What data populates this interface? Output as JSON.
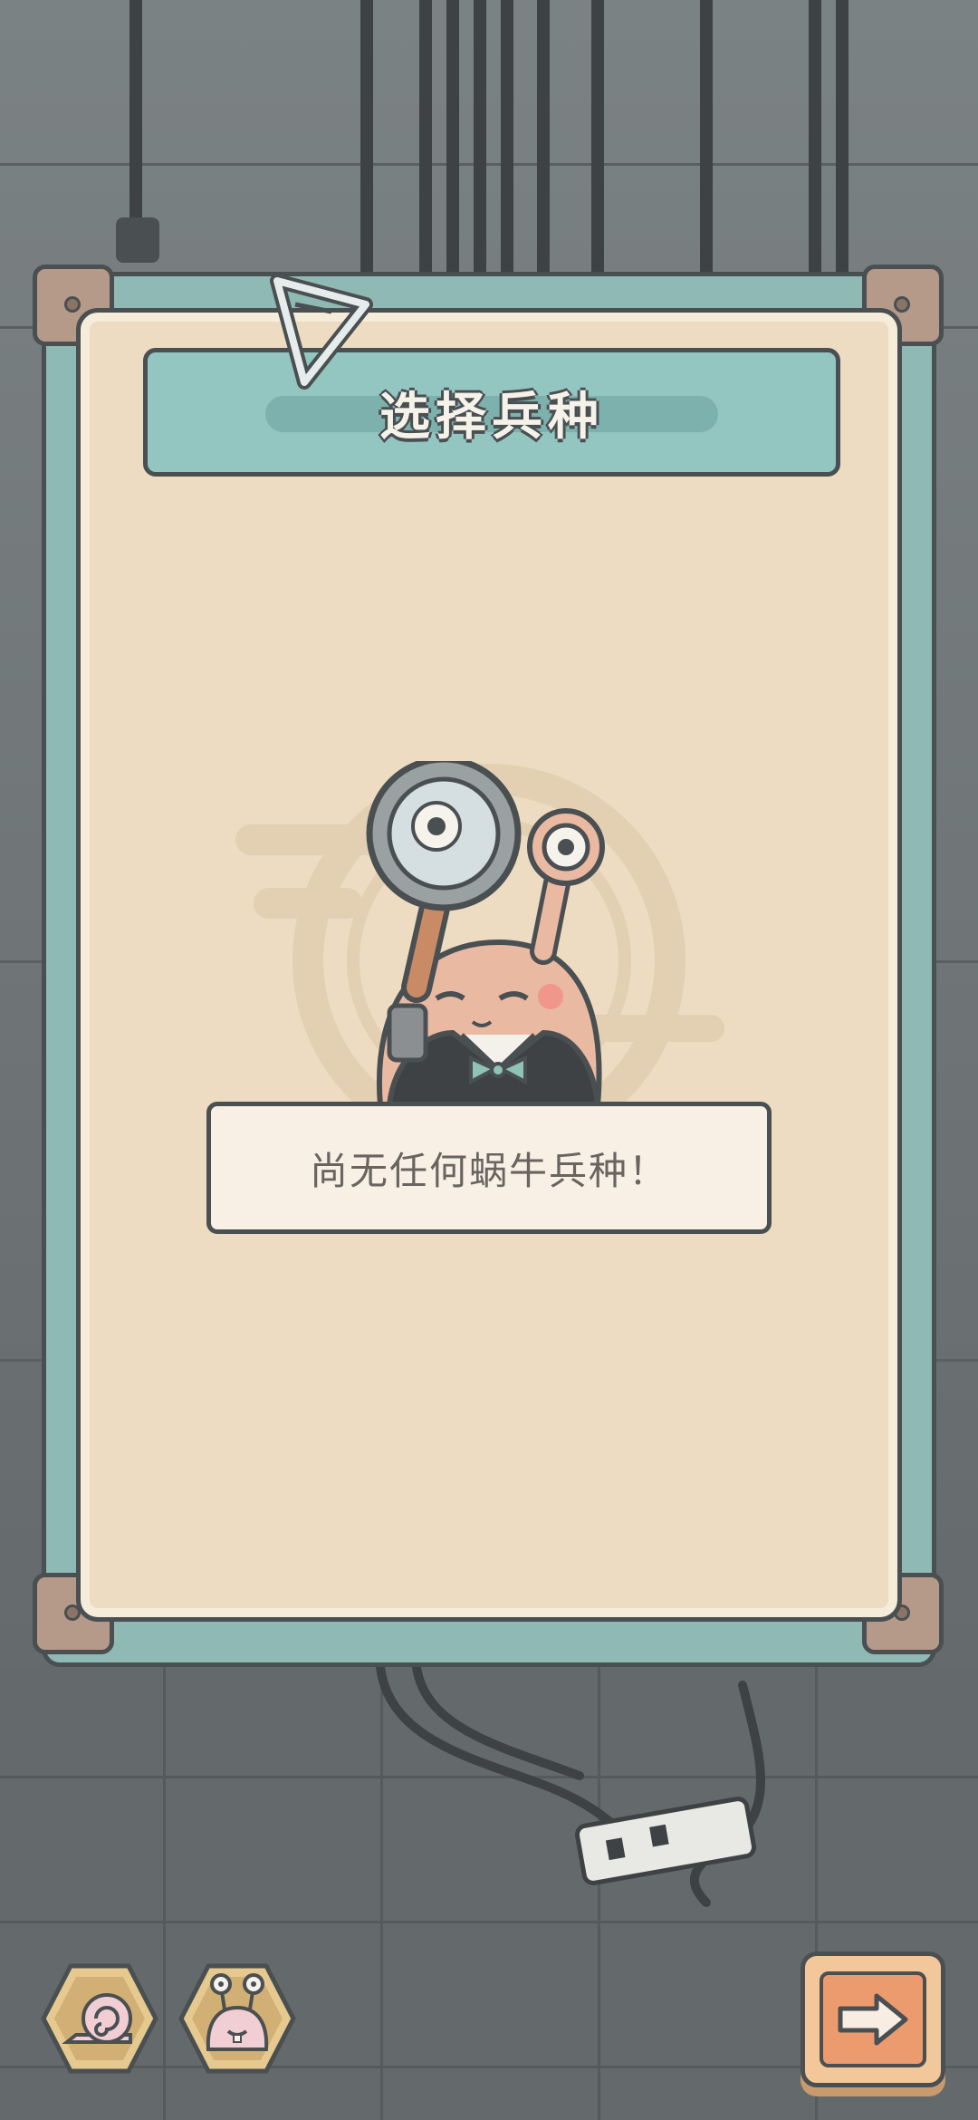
{
  "panel": {
    "title": "选择兵种",
    "empty_message": "尚无任何蜗牛兵种！"
  },
  "icons": {
    "panel_pin": "triangle-pin-icon",
    "placeholder": "snail-inspector-icon",
    "snail_shell_button": "snail-shell-icon",
    "snail_face_button": "snail-face-icon",
    "next_button": "arrow-right-icon"
  },
  "colors": {
    "panel_teal": "#8fb9b5",
    "panel_cream": "#eddcc1",
    "title_teal": "#93c5c1",
    "next_button_orange": "#ec9b6f"
  }
}
